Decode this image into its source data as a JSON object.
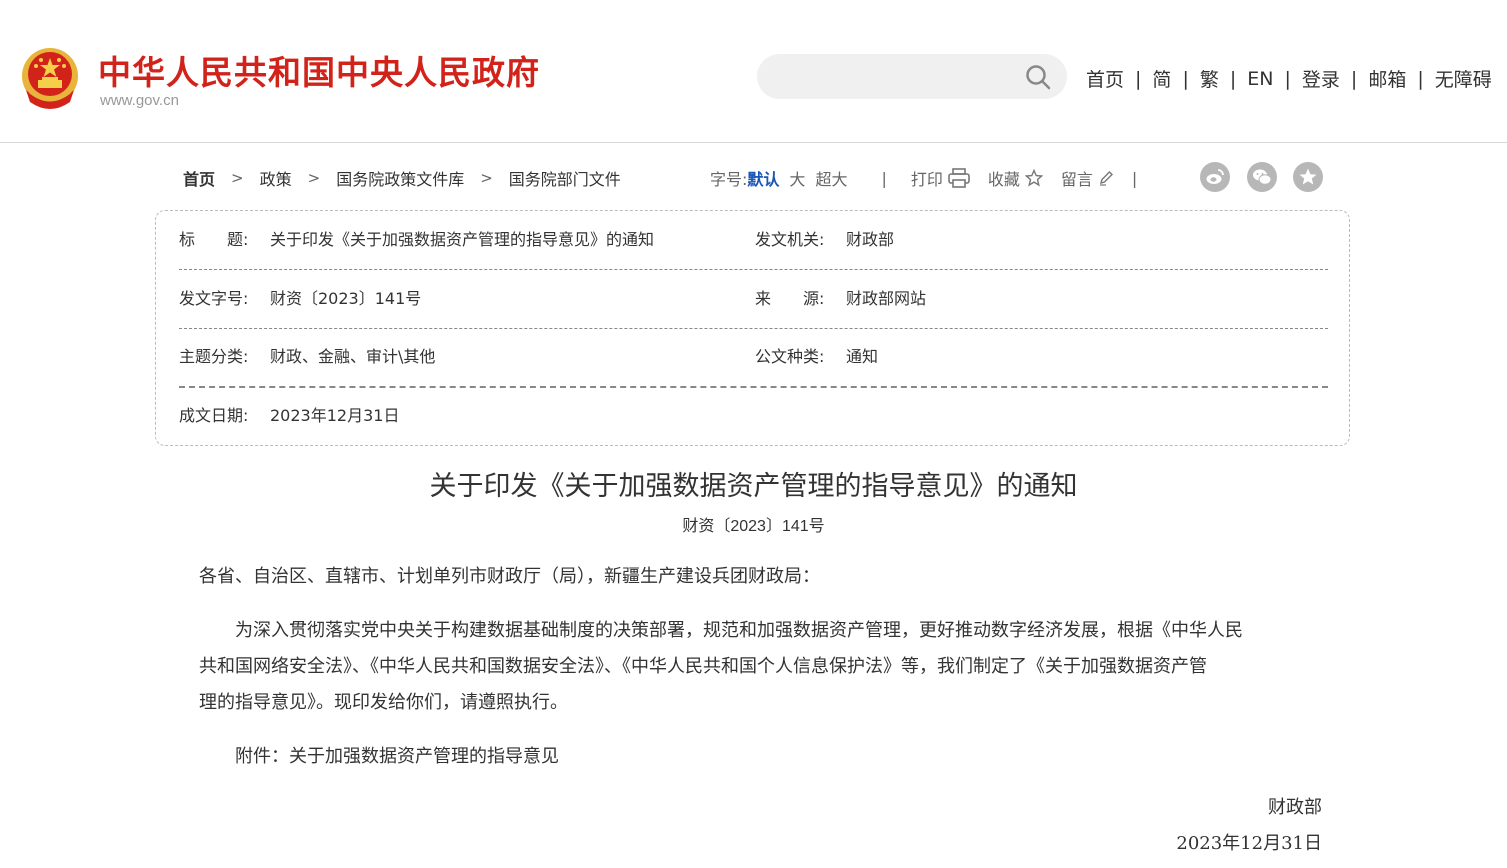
{
  "header": {
    "site_title": "中华人民共和国中央人民政府",
    "site_url": "www.gov.cn",
    "search": {
      "value": "",
      "placeholder": ""
    },
    "nav": [
      "首页",
      "简",
      "繁",
      "EN",
      "登录",
      "邮箱",
      "无障碍"
    ],
    "nav_separator": "|"
  },
  "breadcrumb": {
    "items": [
      "首页",
      "政策",
      "国务院政策文件库",
      "国务院部门文件"
    ],
    "separator": ">"
  },
  "tools": {
    "font_size_label": "字号:",
    "font_sizes": [
      "默认",
      "大",
      "超大"
    ],
    "selected_font_size": "默认",
    "separator": "|",
    "print_label": "打印",
    "favorite_label": "收藏",
    "comment_label": "留言",
    "share_icons": [
      "weibo-icon",
      "wechat-icon",
      "qzone-icon"
    ]
  },
  "info": {
    "title_label": "标　　题:",
    "title_value": "关于印发《关于加强数据资产管理的指导意见》的通知",
    "issuer_label": "发文机关:",
    "issuer_value": "财政部",
    "doc_no_label": "发文字号:",
    "doc_no_value": "财资〔2023〕141号",
    "source_label": "来　　源:",
    "source_value": "财政部网站",
    "category_label": "主题分类:",
    "category_value": "财政、金融、审计\\其他",
    "doc_type_label": "公文种类:",
    "doc_type_value": "通知",
    "date_label": "成文日期:",
    "date_value": "2023年12月31日"
  },
  "document": {
    "title": "关于印发《关于加强数据资产管理的指导意见》的通知",
    "number": "财资〔2023〕141号",
    "addressee": "各省、自治区、直辖市、计划单列市财政厅（局），新疆生产建设兵团财政局：",
    "paragraph_1_line_1": "　　为深入贯彻落实党中央关于构建数据基础制度的决策部署，规范和加强数据资产管理，更好推动数字经济发展，根据《中华人民",
    "paragraph_1_line_2": "共和国网络安全法》、《中华人民共和国数据安全法》、《中华人民共和国个人信息保护法》等，我们制定了《关于加强数据资产管",
    "paragraph_1_line_3": "理的指导意见》。现印发给你们，请遵照执行。",
    "attachment": "　　附件：关于加强数据资产管理的指导意见",
    "signer": "财政部",
    "sign_date": "2023年12月31日"
  },
  "colors": {
    "brand_red": "#d2231b",
    "active_blue": "#1a56b4",
    "share_gray": "#b7b7b7"
  }
}
